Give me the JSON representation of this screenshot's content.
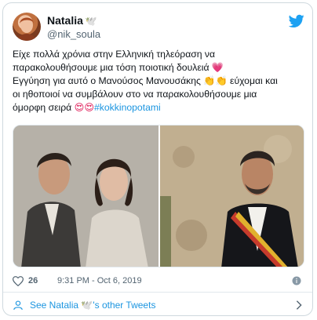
{
  "author": {
    "display_name": "Natalia",
    "handle": "@nik_soula",
    "name_emoji": "🕊️"
  },
  "tweet": {
    "line1": "Είχε πολλά χρόνια στην  Ελληνική τηλεόραση να",
    "line2_prefix": "παρακολουθήσουμε μια τόση ποιοτική δουλειά ",
    "line2_emoji": "💗",
    "line3_prefix": "Εγγύηση για αυτό ο Μανούσος Μανουσάκης ",
    "line3_emoji": "👏👏",
    "line3_suffix": " εύχομαι και",
    "line4": "οι ηθοποιοί να συμβάλουν στο να παρακολουθήσουμε μια",
    "line5_prefix": "όμορφη σειρά ",
    "line5_emoji": "😍😍",
    "hashtag": "#kokkinopotami"
  },
  "engagement": {
    "like_count": "26",
    "timestamp": "9:31 PM - Oct 6, 2019"
  },
  "footer": {
    "prefix": "See Natalia ",
    "emoji": "🕊️",
    "suffix": "'s other Tweets"
  },
  "colors": {
    "accent": "#1b95e0",
    "heart": "#e0245e",
    "text": "#0f1419",
    "muted": "#536471"
  }
}
